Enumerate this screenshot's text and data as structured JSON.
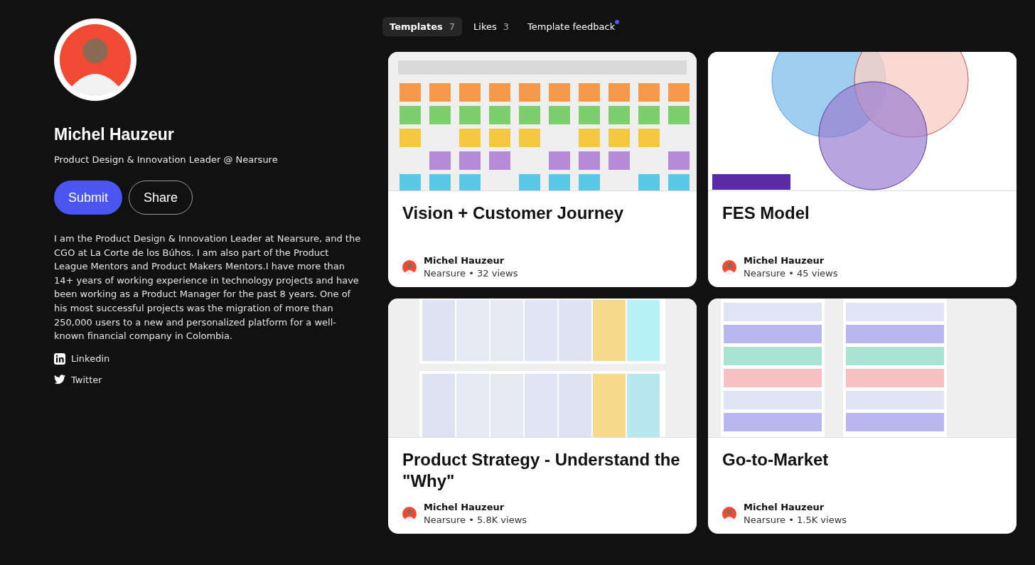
{
  "profile": {
    "name": "Michel Hauzeur",
    "headline": "Product Design & Innovation Leader @ Nearsure",
    "buttons": [
      {
        "label": "Submit",
        "kind": "primary"
      },
      {
        "label": "Share",
        "kind": "outline"
      }
    ],
    "bio": "I am the Product Design & Innovation Leader at Nearsure, and the CGO at La Corte de los Búhos. I am also part of the Product League Mentors and Product Makers Mentors.I have more than 14+ years of working experience in technology projects and have been working as a Product Manager for the past 8 years. One of his most successful projects was the migration of more than 250,000 users to a new and personalized platform for a well-known financial company in Colombia.",
    "links": [
      {
        "label": "Linkedin",
        "kind": "linkedin"
      },
      {
        "label": "Twitter",
        "kind": "twitter"
      }
    ]
  },
  "tabs": [
    {
      "label": "Templates",
      "count": "7",
      "selected": true,
      "dot": false
    },
    {
      "label": "Likes",
      "count": "3",
      "selected": false,
      "dot": false
    },
    {
      "label": "Template feedback",
      "selected": false,
      "dot": true
    }
  ],
  "cards": [
    {
      "title": "Vision + Customer Journey",
      "author": "Michel Hauzeur",
      "meta": "Nearsure • 32 views"
    },
    {
      "title": "FES Model",
      "author": "Michel Hauzeur",
      "meta": "Nearsure • 45 views"
    },
    {
      "title": "Product Strategy - Understand the \"Why\"",
      "author": "Michel Hauzeur",
      "meta": "Nearsure • 5.8K views"
    },
    {
      "title": "Go-to-Market",
      "author": "Michel Hauzeur",
      "meta": "Nearsure • 1.5K views"
    }
  ]
}
